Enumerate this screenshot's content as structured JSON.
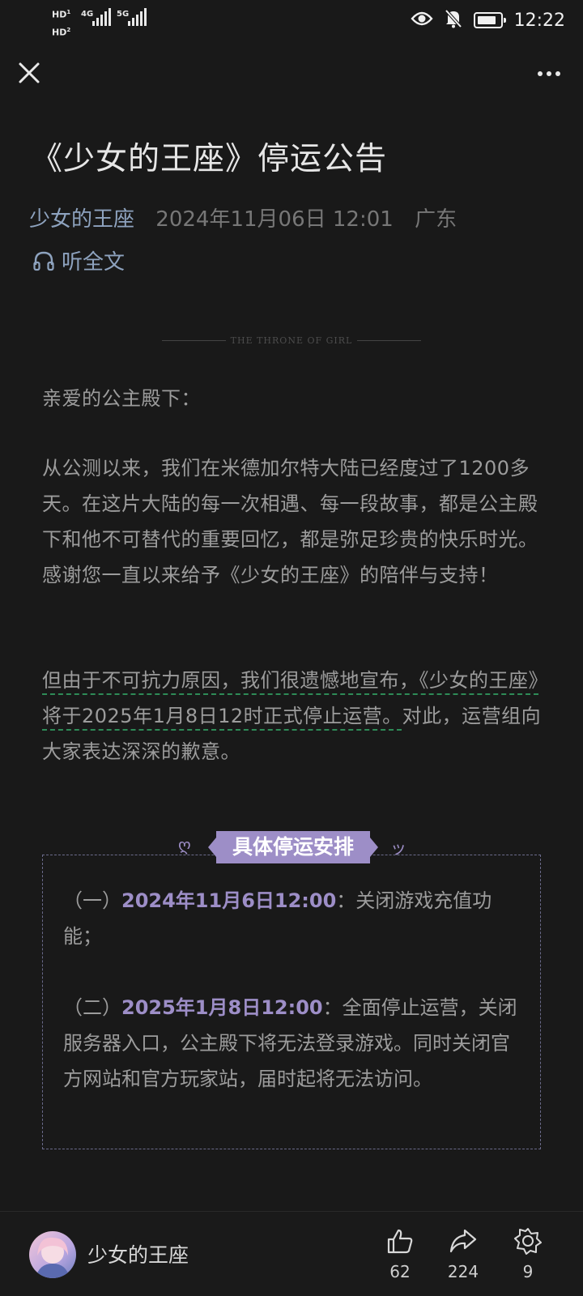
{
  "status_bar": {
    "sim1": "HD",
    "sim1_sub": "1",
    "sim2": "HD",
    "sim2_sub": "2",
    "net1": "4G",
    "net2": "5G",
    "time": "12:22"
  },
  "article": {
    "title": "《少女的王座》停运公告",
    "author": "少女的王座",
    "date": "2024年11月06日 12:01",
    "location": "广东",
    "listen_label": "听全文",
    "divider_text": "THE THRONE OF GIRL",
    "greeting": "亲爱的公主殿下：",
    "para1": "从公测以来，我们在米德加尔特大陆已经度过了1200多天。在这片大陆的每一次相遇、每一段故事，都是公主殿下和他不可替代的重要回忆，都是弥足珍贵的快乐时光。感谢您一直以来给予《少女的王座》的陪伴与支持！",
    "para2_highlight": "但由于不可抗力原因，我们很遗憾地宣布，《少女的王座》将于2025年1月8日12时正式停止运营。",
    "para2_rest": "对此，运营组向大家表达深深的歉意。"
  },
  "schedule": {
    "title": "具体停运安排",
    "items": [
      {
        "prefix": "（一）",
        "date": "2024年11月6日12:00",
        "text": "：关闭游戏充值功能；"
      },
      {
        "prefix": "（二）",
        "date": "2025年1月8日12:00",
        "text": "：全面停止运营，关闭服务器入口，公主殿下将无法登录游戏。同时关闭官方网站和官方玩家站，届时起将无法访问。"
      }
    ]
  },
  "bottom_bar": {
    "author": "少女的王座",
    "like_count": "62",
    "share_count": "224",
    "fav_count": "9"
  },
  "colors": {
    "background": "#191919",
    "accent_purple": "#9d8ec7",
    "author_blue": "#8ea3bf"
  }
}
